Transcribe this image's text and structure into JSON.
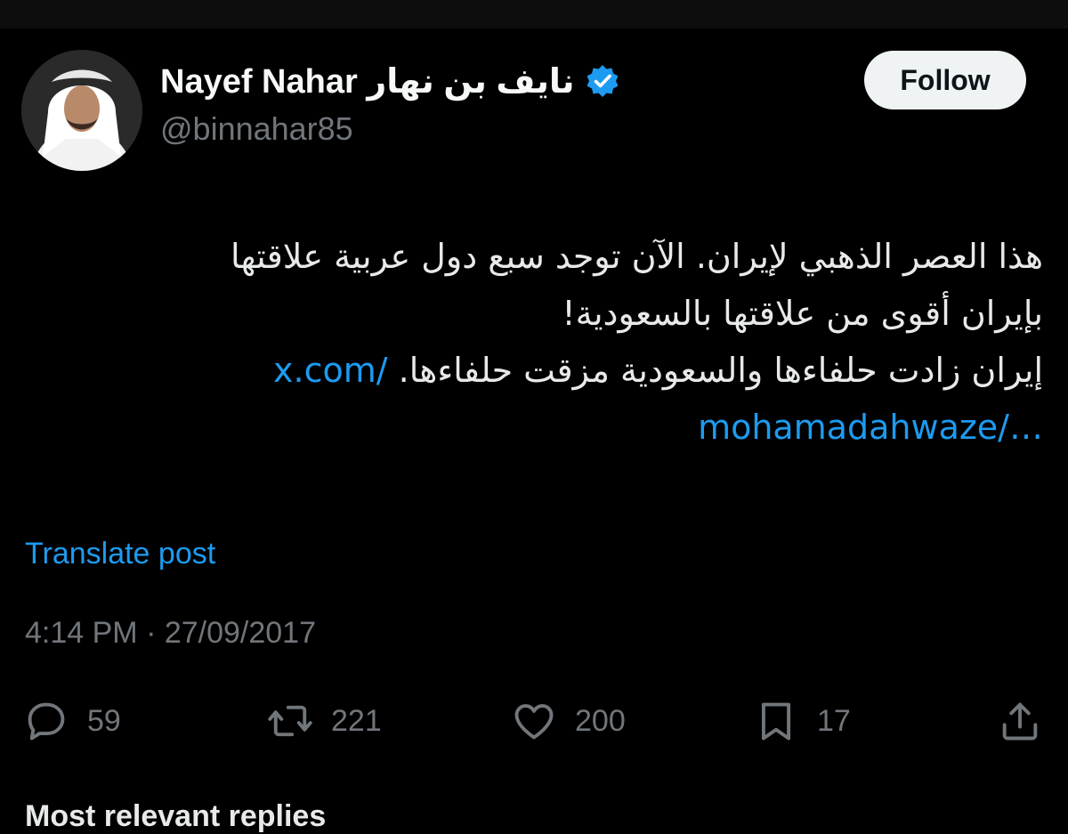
{
  "author": {
    "display_name": "Nayef Nahar نايف بن نهار",
    "handle": "@binnahar85",
    "verified": true
  },
  "follow_button": {
    "label": "Follow"
  },
  "tweet": {
    "line1": "هذا العصر الذهبي لإيران. الآن توجد سبع دول عربية علاقتها",
    "line2": "بإيران أقوى من علاقتها بالسعودية!",
    "line3": "إيران زادت حلفاءها والسعودية مزقت حلفاءها.",
    "link_part1": "x.com/",
    "link_part2": "mohamadahwaze/…"
  },
  "translate": {
    "label": "Translate post"
  },
  "timestamp": "4:14 PM · 27/09/2017",
  "actions": {
    "reply_count": "59",
    "repost_count": "221",
    "like_count": "200",
    "bookmark_count": "17"
  },
  "footer": {
    "label": "Most relevant replies"
  },
  "colors": {
    "accent": "#1d9bf0",
    "muted": "#71767b",
    "background": "#000000"
  },
  "icons": [
    "verified-badge-icon",
    "reply-icon",
    "repost-icon",
    "like-icon",
    "bookmark-icon",
    "share-icon"
  ]
}
